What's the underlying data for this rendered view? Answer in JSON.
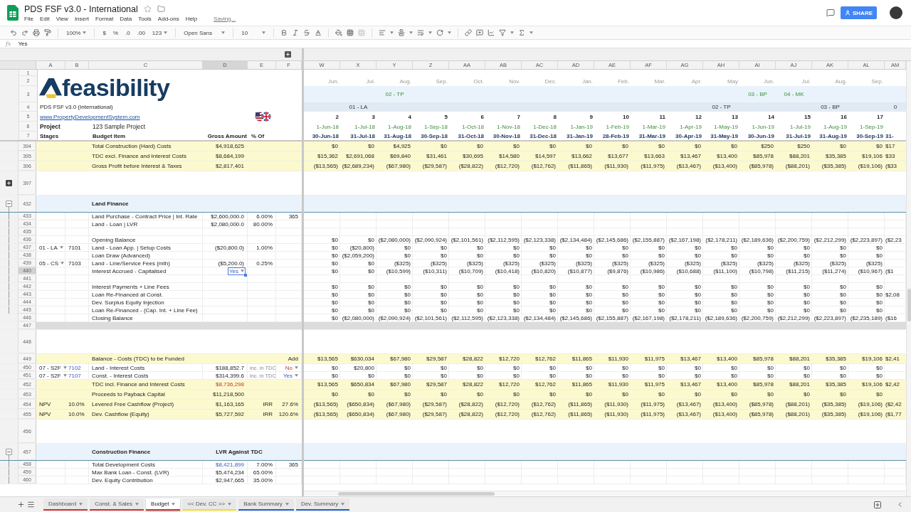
{
  "window": {
    "title": "PDS FSF v3.0 - International",
    "menus": [
      "File",
      "Edit",
      "View",
      "Insert",
      "Format",
      "Data",
      "Tools",
      "Add-ons",
      "Help"
    ],
    "status": "Saving...",
    "share": "SHARE"
  },
  "toolbar": {
    "zoom": "100%",
    "currency": "$",
    "percent": "%",
    "dec_less": ".0",
    "dec_more": ".00",
    "number_format": "123",
    "font": "Open Sans",
    "font_size": "10"
  },
  "formula_bar": {
    "label": "fx",
    "value": "Yes"
  },
  "columns_left": [
    "A",
    "B",
    "C",
    "D",
    "E",
    "F"
  ],
  "header_left": {
    "row_numbers": [
      "1",
      "2",
      "3",
      "4",
      "5",
      "6",
      "7"
    ],
    "logo": "feasibility",
    "info": "PDS FSF v3.0 (International)",
    "link": "www.PropertyDevelopmentSystem.com",
    "project_label": "Project",
    "project_name": "123 Sample Project",
    "stages": "Stages",
    "budget_item": "Budget Item",
    "gross_amount": "Gross Amount",
    "percent_of": "% Of"
  },
  "columns_right": [
    {
      "letter": "W",
      "month": "Jun.",
      "period": "2",
      "start": "1-Jun-18",
      "end": "30-Jun-18"
    },
    {
      "letter": "X",
      "month": "Jul.",
      "phase_lower": "01 - LA",
      "period": "3",
      "start": "1-Jul-18",
      "end": "31-Jul-18"
    },
    {
      "letter": "Y",
      "month": "Aug.",
      "phase_upper": "02 - TP",
      "period": "4",
      "start": "1-Aug-18",
      "end": "31-Aug-18"
    },
    {
      "letter": "Z",
      "month": "Sep.",
      "period": "5",
      "start": "1-Sep-18",
      "end": "30-Sep-18"
    },
    {
      "letter": "AA",
      "month": "Oct.",
      "period": "6",
      "start": "1-Oct-18",
      "end": "31-Oct-18"
    },
    {
      "letter": "AB",
      "month": "Nov.",
      "period": "7",
      "start": "1-Nov-18",
      "end": "30-Nov-18"
    },
    {
      "letter": "AC",
      "month": "Dec.",
      "period": "8",
      "start": "1-Dec-18",
      "end": "31-Dec-18"
    },
    {
      "letter": "AD",
      "month": "Jan.",
      "period": "9",
      "start": "1-Jan-19",
      "end": "31-Jan-19"
    },
    {
      "letter": "AE",
      "month": "Feb.",
      "period": "10",
      "start": "1-Feb-19",
      "end": "28-Feb-19"
    },
    {
      "letter": "AF",
      "month": "Mar.",
      "period": "11",
      "start": "1-Mar-19",
      "end": "31-Mar-19"
    },
    {
      "letter": "AG",
      "month": "Apr.",
      "period": "12",
      "start": "1-Apr-19",
      "end": "30-Apr-19"
    },
    {
      "letter": "AH",
      "month": "May",
      "phase_lower": "02 - TP",
      "period": "13",
      "start": "1-May-19",
      "end": "31-May-19"
    },
    {
      "letter": "AI",
      "month": "Jun.",
      "phase_upper": "03 - BP",
      "period": "14",
      "start": "1-Jun-19",
      "end": "30-Jun-19"
    },
    {
      "letter": "AJ",
      "month": "Jul.",
      "phase_upper": "04 - MK",
      "period": "15",
      "start": "1-Jul-19",
      "end": "31-Jul-19"
    },
    {
      "letter": "AK",
      "month": "Aug.",
      "phase_lower": "03 - BP",
      "period": "16",
      "start": "1-Aug-19",
      "end": "31-Aug-19"
    },
    {
      "letter": "AL",
      "month": "Sep.",
      "period": "17",
      "start": "1-Sep-19",
      "end": "30-Sep-19"
    },
    {
      "letter": "AM",
      "phase_lower": "0",
      "end": "31-"
    }
  ],
  "rows": [
    {
      "num": "394",
      "kind": "total",
      "cells": {
        "c": "Total Construction (Hard) Costs",
        "d": "$4,918,625"
      },
      "values": [
        "$0",
        "$0",
        "$4,925",
        "$0",
        "$0",
        "$0",
        "$0",
        "$0",
        "$0",
        "$0",
        "$0",
        "$0",
        "$250",
        "$250",
        "$0",
        "$0",
        "$17"
      ]
    },
    {
      "num": "395",
      "kind": "total",
      "cells": {
        "c": "TDC excl. Finance and Interest Costs",
        "d": "$8,684,199"
      },
      "values": [
        "$15,362",
        "$2,691,068",
        "$69,840",
        "$31,461",
        "$30,695",
        "$14,580",
        "$14,597",
        "$13,662",
        "$13,677",
        "$13,663",
        "$13,467",
        "$13,400",
        "$85,978",
        "$88,201",
        "$35,385",
        "$19,106",
        "$33"
      ]
    },
    {
      "num": "396",
      "kind": "total",
      "cells": {
        "c": "Gross Profit before Interest & Taxes",
        "d": "$2,817,401"
      },
      "values": [
        "($13,565)",
        "($2,689,234)",
        "($67,980)",
        "($29,587)",
        "($28,822)",
        "($12,720)",
        "($12,762)",
        "($11,865)",
        "($11,930)",
        "($11,975)",
        "($13,467)",
        "($13,400)",
        "($85,978)",
        "($88,201)",
        "($35,385)",
        "($19,106)",
        "($33"
      ]
    },
    {
      "num": "397",
      "kind": "spacer",
      "expanded": false
    },
    {
      "num": "432",
      "kind": "section",
      "expanded": true,
      "cells": {
        "c": "Land Finance"
      }
    },
    {
      "num": "433",
      "kind": "line",
      "grouped": true,
      "cells": {
        "c": "Land Purchase - Contract Price | Int. Rate",
        "d": "$2,600,000.0",
        "e": "6.00%",
        "f": "365"
      }
    },
    {
      "num": "434",
      "kind": "line",
      "grouped": true,
      "cells": {
        "c": "Land - Loan | LVR",
        "d": "$2,080,000.0",
        "e": "80.00%"
      }
    },
    {
      "num": "435",
      "kind": "line",
      "grouped": true
    },
    {
      "num": "436",
      "kind": "line",
      "grouped": true,
      "cells": {
        "c": "Opening Balance"
      },
      "values": [
        "$0",
        "$0",
        "($2,080,000)",
        "($2,090,924)",
        "($2,101,561)",
        "($2,112,595)",
        "($2,123,338)",
        "($2,134,484)",
        "($2,145,686)",
        "($2,155,887)",
        "($2,167,198)",
        "($2,178,211)",
        "($2,189,636)",
        "($2,200,759)",
        "($2,212,299)",
        "($2,223,897)",
        "($2,23"
      ]
    },
    {
      "num": "437",
      "kind": "line",
      "grouped": true,
      "cells": {
        "a": {
          "text": "01 - LA",
          "dropdown": true
        },
        "b": "7101",
        "c": "Land - Loan App. | Setup Costs",
        "d": "($20,800.0)",
        "e": "1.00%"
      },
      "values": [
        "$0",
        "($20,800)",
        "$0",
        "$0",
        "$0",
        "$0",
        "$0",
        "$0",
        "$0",
        "$0",
        "$0",
        "$0",
        "$0",
        "$0",
        "$0",
        "$0"
      ]
    },
    {
      "num": "438",
      "kind": "line",
      "grouped": true,
      "cells": {
        "c": "Loan Draw (Advanced)"
      },
      "values": [
        "$0",
        "($2,059,200)",
        "$0",
        "$0",
        "$0",
        "$0",
        "$0",
        "$0",
        "$0",
        "$0",
        "$0",
        "$0",
        "$0",
        "$0",
        "$0",
        "$0"
      ]
    },
    {
      "num": "439",
      "kind": "line",
      "grouped": true,
      "cells": {
        "a": {
          "text": "05 - CS",
          "dropdown": true
        },
        "b": "7103",
        "c": "Land - Line/Service Fees  (mth)",
        "d": "($5,200.0)",
        "e": "0.25%"
      },
      "values": [
        "$0",
        "$0",
        "($325)",
        "($325)",
        "($325)",
        "($325)",
        "($325)",
        "($325)",
        "($325)",
        "($325)",
        "($325)",
        "($325)",
        "($325)",
        "($325)",
        "($325)",
        "($325)"
      ]
    },
    {
      "num": "440",
      "kind": "line",
      "grouped": true,
      "cells": {
        "c": "Interest Accrued - Capitalised",
        "d": {
          "text": "Yes",
          "dropdown": true,
          "selected": true,
          "linked": true
        }
      },
      "values": [
        "$0",
        "$0",
        "($10,599)",
        "($10,311)",
        "($10,709)",
        "($10,418)",
        "($10,820)",
        "($10,877)",
        "($9,876)",
        "($10,986)",
        "($10,688)",
        "($11,100)",
        "($10,798)",
        "($11,215)",
        "($11,274)",
        "($10,967)",
        "($1"
      ]
    },
    {
      "num": "441",
      "kind": "line",
      "grouped": true
    },
    {
      "num": "442",
      "kind": "line",
      "grouped": true,
      "cells": {
        "c": "Interest Payments + Line Fees"
      },
      "values": [
        "$0",
        "$0",
        "$0",
        "$0",
        "$0",
        "$0",
        "$0",
        "$0",
        "$0",
        "$0",
        "$0",
        "$0",
        "$0",
        "$0",
        "$0",
        "$0"
      ]
    },
    {
      "num": "443",
      "kind": "line",
      "grouped": true,
      "cells": {
        "c": "Loan Re-Financed at Const."
      },
      "values": [
        "$0",
        "$0",
        "$0",
        "$0",
        "$0",
        "$0",
        "$0",
        "$0",
        "$0",
        "$0",
        "$0",
        "$0",
        "$0",
        "$0",
        "$0",
        "$0",
        "$2,08"
      ]
    },
    {
      "num": "444",
      "kind": "line",
      "grouped": true,
      "cells": {
        "c": "Dev. Surplus Equity Injection"
      },
      "values": [
        "$0",
        "$0",
        "$0",
        "$0",
        "$0",
        "$0",
        "$0",
        "$0",
        "$0",
        "$0",
        "$0",
        "$0",
        "$0",
        "$0",
        "$0",
        "$0"
      ]
    },
    {
      "num": "445",
      "kind": "line",
      "grouped": true,
      "cells": {
        "c": "Loan Re-Financed - (Cap. Int. + Line Fee)"
      },
      "values": [
        "$0",
        "$0",
        "$0",
        "$0",
        "$0",
        "$0",
        "$0",
        "$0",
        "$0",
        "$0",
        "$0",
        "$0",
        "$0",
        "$0",
        "$0",
        "$0"
      ]
    },
    {
      "num": "446",
      "kind": "line",
      "cells": {
        "c": "Closing Balance"
      },
      "values": [
        "$0",
        "($2,080,000)",
        "($2,090,924)",
        "($2,101,561)",
        "($2,112,595)",
        "($2,123,338)",
        "($2,134,484)",
        "($2,145,686)",
        "($2,155,887)",
        "($2,167,198)",
        "($2,178,211)",
        "($2,189,636)",
        "($2,200,759)",
        "($2,212,299)",
        "($2,223,897)",
        "($2,235,189)",
        "($16"
      ]
    },
    {
      "num": "447",
      "kind": "divider"
    },
    {
      "num": "448",
      "kind": "spacer"
    },
    {
      "num": "449",
      "kind": "total",
      "cells": {
        "c": "Balance - Costs (TDC) to be Funded",
        "f": "Add"
      },
      "values": [
        "$13,565",
        "$630,034",
        "$67,980",
        "$29,587",
        "$28,822",
        "$12,720",
        "$12,762",
        "$11,865",
        "$11,930",
        "$11,975",
        "$13,467",
        "$13,400",
        "$85,978",
        "$88,201",
        "$35,385",
        "$19,106",
        "$2,41"
      ]
    },
    {
      "num": "450",
      "kind": "line",
      "cells": {
        "a": {
          "text": "07 - S2F",
          "dropdown": true
        },
        "b": {
          "text": "7102",
          "linked": true
        },
        "c": "Land - Interest Costs",
        "d": "$188,852.7",
        "e": {
          "text": "inc. in TDC",
          "note": true
        },
        "f": {
          "text": "No",
          "dropdown": true,
          "warning": true
        }
      },
      "values": [
        "$0",
        "$20,800",
        "$0",
        "$0",
        "$0",
        "$0",
        "$0",
        "$0",
        "$0",
        "$0",
        "$0",
        "$0",
        "$0",
        "$0",
        "$0",
        "$0"
      ]
    },
    {
      "num": "451",
      "kind": "line",
      "cells": {
        "a": {
          "text": "07 - S2F",
          "dropdown": true
        },
        "b": {
          "text": "7107",
          "linked": true
        },
        "c": "Const. - Interest Costs",
        "d": "$314,399.6",
        "e": {
          "text": "inc. in TDC",
          "note": true
        },
        "f": {
          "text": "Yes",
          "dropdown": true,
          "linked": true
        }
      },
      "values": [
        "$0",
        "$0",
        "$0",
        "$0",
        "$0",
        "$0",
        "$0",
        "$0",
        "$0",
        "$0",
        "$0",
        "$0",
        "$0",
        "$0",
        "$0",
        "$0"
      ]
    },
    {
      "num": "452",
      "kind": "total",
      "cells": {
        "c": "TDC incl. Finance and Interest Costs",
        "d": {
          "text": "$8,736,298",
          "warning": true
        }
      },
      "values": [
        "$13,565",
        "$650,834",
        "$67,980",
        "$29,587",
        "$28,822",
        "$12,720",
        "$12,762",
        "$11,865",
        "$11,930",
        "$11,975",
        "$13,467",
        "$13,400",
        "$85,978",
        "$88,201",
        "$35,385",
        "$19,106",
        "$2,42"
      ]
    },
    {
      "num": "453",
      "kind": "total",
      "cells": {
        "c": "Proceeds to Payback Capital",
        "d": "$11,218,500"
      },
      "values": [
        "$0",
        "$0",
        "$0",
        "$0",
        "$0",
        "$0",
        "$0",
        "$0",
        "$0",
        "$0",
        "$0",
        "$0",
        "$0",
        "$0",
        "$0",
        "$0"
      ]
    },
    {
      "num": "454",
      "kind": "total",
      "cells": {
        "a": "NPV",
        "b": "10.0%",
        "c": "Levered Free Cashflow (Project)",
        "d": "$1,163,165",
        "e": "IRR",
        "f": "27.6%"
      },
      "values": [
        "($13,565)",
        "($650,834)",
        "($67,980)",
        "($29,587)",
        "($28,822)",
        "($12,720)",
        "($12,762)",
        "($11,865)",
        "($11,930)",
        "($11,975)",
        "($13,467)",
        "($13,400)",
        "($85,978)",
        "($88,201)",
        "($35,385)",
        "($19,106)",
        "($2,42"
      ]
    },
    {
      "num": "455",
      "kind": "total",
      "cells": {
        "a": "NPV",
        "b": "10.0%",
        "c": "Dev. Cashflow (Equity)",
        "d": "$5,727,592",
        "e": "IRR",
        "f": "120.6%"
      },
      "values": [
        "($13,565)",
        "($650,834)",
        "($67,980)",
        "($29,587)",
        "($28,822)",
        "($12,720)",
        "($12,762)",
        "($11,865)",
        "($11,930)",
        "($11,975)",
        "($13,467)",
        "($13,400)",
        "($85,978)",
        "($88,201)",
        "($35,385)",
        "($19,106)",
        "($1,77"
      ]
    },
    {
      "num": "456",
      "kind": "spacer"
    },
    {
      "num": "457",
      "kind": "section",
      "expanded": true,
      "cells": {
        "c": "Construction Finance",
        "d": "LVR Against TDC"
      }
    },
    {
      "num": "458",
      "kind": "line",
      "grouped": true,
      "cells": {
        "c": "Total Development Costs",
        "d": {
          "text": "$8,421,899",
          "linked": true
        },
        "e": "7.00%",
        "f": "365"
      }
    },
    {
      "num": "459",
      "kind": "line",
      "grouped": true,
      "cells": {
        "c": "Max Bank Loan - Const. (LVR)",
        "d": "$5,474,234",
        "e": "65.00%"
      }
    },
    {
      "num": "460",
      "kind": "line",
      "grouped": true,
      "cells": {
        "c": "Dev. Equity Contribution",
        "d": "$2,947,665",
        "e": "35.00%"
      }
    }
  ],
  "sheet_tabs": [
    {
      "label": "Dashboard",
      "selected": false,
      "color": "#d32f2f"
    },
    {
      "label": "Const. & Sales",
      "selected": false,
      "color": "#d32f2f"
    },
    {
      "label": "Budget",
      "selected": true,
      "color": "#d32f2f"
    },
    {
      "label": "<< Dev. CC >>",
      "selected": false,
      "color": "#f4e11c"
    },
    {
      "label": "Bank Summary",
      "selected": false,
      "color": "#1e5fd6"
    },
    {
      "label": "Dev. Summary",
      "selected": false,
      "color": "#1e5fd6"
    }
  ]
}
